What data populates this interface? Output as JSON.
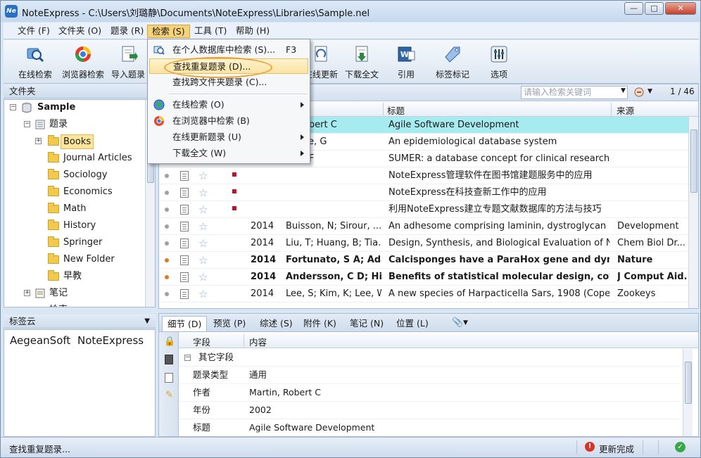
{
  "window": {
    "title": "NoteExpress - C:\\Users\\刘璐静\\Documents\\NoteExpress\\Libraries\\Sample.nel",
    "app_icon": "Ne",
    "min": "—",
    "max": "□",
    "close": "✕"
  },
  "menubar": [
    {
      "label": "文件 (F)"
    },
    {
      "label": "文件夹 (O)"
    },
    {
      "label": "题录 (R)"
    },
    {
      "label": "检索 (S)"
    },
    {
      "label": "工具 (T)"
    },
    {
      "label": "帮助 (H)"
    }
  ],
  "toolbar": [
    {
      "label": "在线检索",
      "icon": "online-search-icon"
    },
    {
      "label": "浏览器检索",
      "icon": "browser-icon"
    },
    {
      "label": "导入题录",
      "icon": "import-icon"
    },
    {
      "label": "在线更新",
      "icon": "update-icon"
    },
    {
      "label": "下载全文",
      "icon": "download-icon"
    },
    {
      "label": "引用",
      "icon": "cite-icon"
    },
    {
      "label": "标签标记",
      "icon": "tag-icon"
    },
    {
      "label": "选项",
      "icon": "options-icon"
    }
  ],
  "search_menu": {
    "items": [
      {
        "label": "在个人数据库中检索 (S)...",
        "shortcut": "F3"
      },
      {
        "label": "查找重复题录 (D)..."
      },
      {
        "label": "查找跨文件夹题录 (C)..."
      },
      {
        "label": "在线检索 (O)"
      },
      {
        "label": "在浏览器中检索 (B)"
      },
      {
        "label": "在线更新题录 (U)"
      },
      {
        "label": "下载全文 (W)"
      }
    ]
  },
  "folders": {
    "title": "文件夹",
    "library": "Sample",
    "refs_node": "题录",
    "items": [
      "Books",
      "Journal Articles",
      "Sociology",
      "Economics",
      "Math",
      "History",
      "Springer",
      "New Folder",
      "早教"
    ],
    "notes_node": "笔记",
    "search_node": "检索"
  },
  "tagcloud": {
    "title": "标签云",
    "tags": [
      "AegeanSoft",
      "NoteExpress"
    ]
  },
  "references": {
    "search_placeholder": "请输入检索关键词",
    "count": "1 / 46",
    "columns": {
      "author": "作者",
      "title": "标题",
      "source": "来源"
    },
    "rows": [
      {
        "year": "",
        "author": "n, Robert C",
        "title": "Agile Software Development",
        "source": "",
        "bold": false,
        "selected": true,
        "orange": false,
        "red": false
      },
      {
        "year": "",
        "author": "atchie, G",
        "title": "An epidemiological database system",
        "source": "",
        "bold": false,
        "selected": false,
        "orange": false,
        "red": false
      },
      {
        "year": "",
        "author": "han, F",
        "title": "SUMER: a database concept for clinical research ...",
        "source": "",
        "bold": false,
        "selected": false,
        "orange": false,
        "red": false
      },
      {
        "year": "",
        "author": "",
        "title": "NoteExpress管理软件在图书馆建题服务中的应用",
        "source": "",
        "bold": false,
        "selected": false,
        "orange": false,
        "red": true
      },
      {
        "year": "",
        "author": "",
        "title": "NoteExpress在科技查新工作中的应用",
        "source": "",
        "bold": false,
        "selected": false,
        "orange": false,
        "red": true
      },
      {
        "year": "",
        "author": "",
        "title": "利用NoteExpress建立专题文献数据库的方法与技巧",
        "source": "",
        "bold": false,
        "selected": false,
        "orange": false,
        "red": true
      },
      {
        "year": "2014",
        "author": "Buisson, N; Sirour, ...",
        "title": "An adhesome comprising laminin, dystroglycan a...",
        "source": "Development",
        "bold": false,
        "selected": false,
        "orange": false,
        "red": false
      },
      {
        "year": "2014",
        "author": "Liu, T; Huang, B; Tia...",
        "title": "Design, Synthesis, and Biological Evaluation of N...",
        "source": "Chem Biol Dr...",
        "bold": false,
        "selected": false,
        "orange": false,
        "red": false
      },
      {
        "year": "2014",
        "author": "Fortunato, S A; Ada.",
        "title": "Calcisponges have a ParaHox gene and dynam",
        "source": "Nature",
        "bold": true,
        "selected": false,
        "orange": true,
        "red": false
      },
      {
        "year": "2014",
        "author": "Andersson, C D; Hill",
        "title": "Benefits of statistical molecular design, covaria",
        "source": "J Comput Aid.",
        "bold": true,
        "selected": false,
        "orange": true,
        "red": false
      },
      {
        "year": "2014",
        "author": "Lee, S; Kim, K; Lee, W",
        "title": "A new species of Harpacticella Sars, 1908 (Copep...",
        "source": "Zookeys",
        "bold": false,
        "selected": false,
        "orange": false,
        "red": false
      }
    ]
  },
  "detail": {
    "tabs": [
      "细节 (D)",
      "预览 (P)",
      "综述 (S)",
      "附件 (K)",
      "笔记 (N)",
      "位置 (L)"
    ],
    "col_field": "字段",
    "col_content": "内容",
    "group": "其它字段",
    "rows": [
      {
        "field": "题录类型",
        "value": "通用"
      },
      {
        "field": "作者",
        "value": "Martin, Robert C"
      },
      {
        "field": "年份",
        "value": "2002"
      },
      {
        "field": "标题",
        "value": "Agile Software Development"
      }
    ]
  },
  "status": {
    "left": "查找重复题录...",
    "update": "更新完成"
  }
}
